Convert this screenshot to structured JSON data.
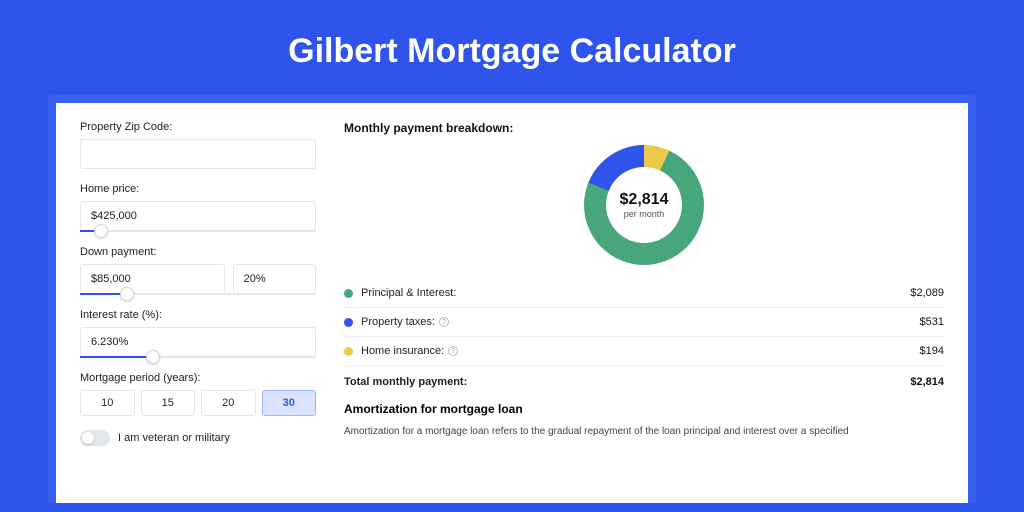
{
  "title": "Gilbert Mortgage Calculator",
  "inputs": {
    "zip_label": "Property Zip Code:",
    "zip_value": "",
    "home_price_label": "Home price:",
    "home_price_value": "$425,000",
    "home_price_slider_pct": 9,
    "down_payment_label": "Down payment:",
    "down_payment_value": "$85,000",
    "down_payment_pct_value": "20%",
    "down_payment_slider_pct": 20,
    "interest_label": "Interest rate (%):",
    "interest_value": "6.230%",
    "interest_slider_pct": 31,
    "period_label": "Mortgage period (years):",
    "period_options": [
      "10",
      "15",
      "20",
      "30"
    ],
    "period_selected": "30",
    "veteran_label": "I am veteran or military"
  },
  "breakdown": {
    "title": "Monthly payment breakdown:",
    "center_value": "$2,814",
    "center_label": "per month",
    "items": [
      {
        "label": "Principal & Interest:",
        "value": "$2,089",
        "color": "green",
        "info": false
      },
      {
        "label": "Property taxes:",
        "value": "$531",
        "color": "blue",
        "info": true
      },
      {
        "label": "Home insurance:",
        "value": "$194",
        "color": "yellow",
        "info": true
      }
    ],
    "total_label": "Total monthly payment:",
    "total_value": "$2,814"
  },
  "amortization": {
    "title": "Amortization for mortgage loan",
    "body": "Amortization for a mortgage loan refers to the gradual repayment of the loan principal and interest over a specified"
  },
  "chart_data": {
    "type": "pie",
    "title": "Monthly payment breakdown",
    "series": [
      {
        "name": "Principal & Interest",
        "value": 2089,
        "color": "#48a77a"
      },
      {
        "name": "Property taxes",
        "value": 531,
        "color": "#2f54eb"
      },
      {
        "name": "Home insurance",
        "value": 194,
        "color": "#edc94b"
      }
    ],
    "total": 2814,
    "center_label": "per month"
  }
}
